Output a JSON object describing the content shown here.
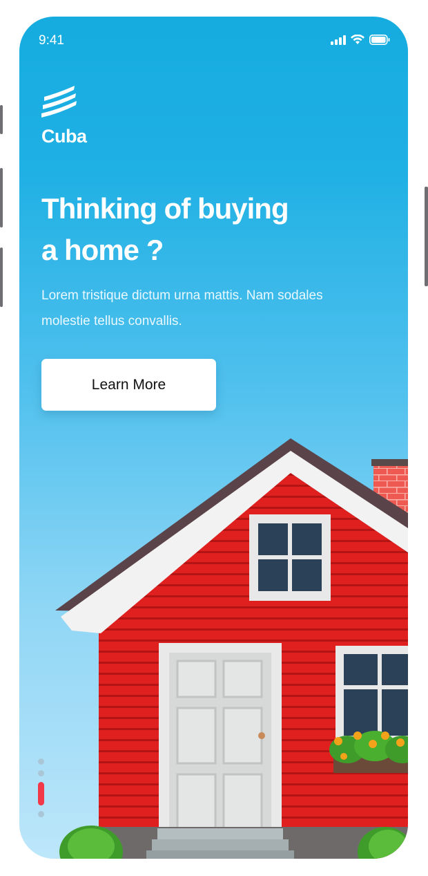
{
  "status_bar": {
    "time": "9:41"
  },
  "brand": {
    "name": "Cuba"
  },
  "hero": {
    "title_line1": "Thinking of buying",
    "title_line2": "a home ?",
    "description": "Lorem tristique dictum urna mattis. Nam sodales molestie tellus convallis.",
    "cta_label": "Learn More"
  },
  "pager": {
    "total": 4,
    "active_index": 2
  },
  "colors": {
    "sky_top": "#16ace0",
    "accent": "#f2394a",
    "house_wall": "#e0201f"
  },
  "icons": [
    "signal-icon",
    "wifi-icon",
    "battery-icon",
    "logo-icon"
  ]
}
